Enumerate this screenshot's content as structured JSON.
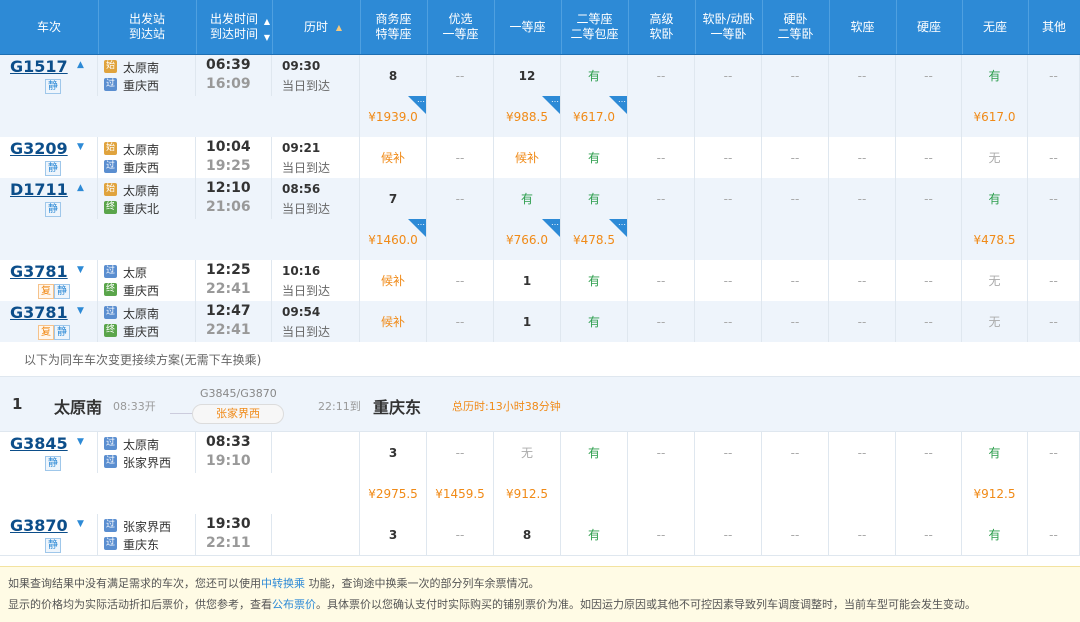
{
  "header": {
    "cols": [
      {
        "l1": "车次",
        "l2": ""
      },
      {
        "l1": "出发站",
        "l2": "到达站"
      },
      {
        "l1": "出发时间",
        "l2": "到达时间"
      },
      {
        "l1": "历时",
        "l2": ""
      },
      {
        "l1": "商务座",
        "l2": "特等座"
      },
      {
        "l1": "优选",
        "l2": "一等座"
      },
      {
        "l1": "一等座",
        "l2": ""
      },
      {
        "l1": "二等座",
        "l2": "二等包座"
      },
      {
        "l1": "高级",
        "l2": "软卧"
      },
      {
        "l1": "软卧/动卧",
        "l2": "一等卧"
      },
      {
        "l1": "硬卧",
        "l2": "二等卧"
      },
      {
        "l1": "软座",
        "l2": ""
      },
      {
        "l1": "硬座",
        "l2": ""
      },
      {
        "l1": "无座",
        "l2": ""
      },
      {
        "l1": "其他",
        "l2": ""
      }
    ]
  },
  "trains": [
    {
      "no": "G1517",
      "tags": [
        "静"
      ],
      "from": "太原南",
      "to": "重庆西",
      "from_icon": "始",
      "to_icon": "过",
      "dep": "06:39",
      "arr": "16:09",
      "dur": "09:30",
      "day": "当日到达",
      "seats": [
        "8",
        "--",
        "12",
        "有",
        "--",
        "--",
        "--",
        "--",
        "--",
        "有",
        "--"
      ],
      "prices": [
        "¥1939.0",
        "",
        "¥988.5",
        "¥617.0",
        "",
        "",
        "",
        "",
        "",
        "¥617.0",
        ""
      ]
    },
    {
      "no": "G3209",
      "tags": [
        "静"
      ],
      "from": "太原南",
      "to": "重庆西",
      "from_icon": "始",
      "to_icon": "过",
      "dep": "10:04",
      "arr": "19:25",
      "dur": "09:21",
      "day": "当日到达",
      "seats": [
        "候补",
        "--",
        "候补",
        "有",
        "--",
        "--",
        "--",
        "--",
        "--",
        "无",
        "--"
      ],
      "prices": null
    },
    {
      "no": "D1711",
      "tags": [
        "静"
      ],
      "from": "太原南",
      "to": "重庆北",
      "from_icon": "始",
      "to_icon": "终",
      "dep": "12:10",
      "arr": "21:06",
      "dur": "08:56",
      "day": "当日到达",
      "seats": [
        "7",
        "--",
        "有",
        "有",
        "--",
        "--",
        "--",
        "--",
        "--",
        "有",
        "--"
      ],
      "prices": [
        "¥1460.0",
        "",
        "¥766.0",
        "¥478.5",
        "",
        "",
        "",
        "",
        "",
        "¥478.5",
        ""
      ]
    },
    {
      "no": "G3781",
      "tags": [
        "复",
        "静"
      ],
      "from": "太原",
      "to": "重庆西",
      "from_icon": "过",
      "to_icon": "终",
      "dep": "12:25",
      "arr": "22:41",
      "dur": "10:16",
      "day": "当日到达",
      "seats": [
        "候补",
        "--",
        "1",
        "有",
        "--",
        "--",
        "--",
        "--",
        "--",
        "无",
        "--"
      ],
      "prices": null
    },
    {
      "no": "G3781",
      "tags": [
        "复",
        "静"
      ],
      "from": "太原南",
      "to": "重庆西",
      "from_icon": "过",
      "to_icon": "终",
      "dep": "12:47",
      "arr": "22:41",
      "dur": "09:54",
      "day": "当日到达",
      "seats": [
        "候补",
        "--",
        "1",
        "有",
        "--",
        "--",
        "--",
        "--",
        "--",
        "无",
        "--"
      ],
      "prices": null
    }
  ],
  "transfer_note": "以下为同车车次变更接续方案(无需下车换乘)",
  "transfer": {
    "index": "1",
    "from": "太原南",
    "dep": "08:33开",
    "trains": "G3845/G3870",
    "via": "张家界西",
    "arr": "22:11到",
    "to": "重庆东",
    "total": "总历时:13小时38分钟"
  },
  "transfer_trains": [
    {
      "no": "G3845",
      "tags": [
        "静"
      ],
      "from": "太原南",
      "to": "张家界西",
      "from_icon": "过",
      "to_icon": "过",
      "dep": "08:33",
      "arr": "19:10",
      "seats": [
        "3",
        "--",
        "无",
        "有",
        "--",
        "--",
        "--",
        "--",
        "--",
        "有",
        "--"
      ],
      "prices": [
        "¥2975.5",
        "¥1459.5",
        "¥912.5",
        "",
        "",
        "",
        "",
        "",
        "",
        "¥912.5",
        ""
      ]
    },
    {
      "no": "G3870",
      "tags": [
        "静"
      ],
      "from": "张家界西",
      "to": "重庆东",
      "from_icon": "过",
      "to_icon": "过",
      "dep": "19:30",
      "arr": "22:11",
      "seats": [
        "3",
        "--",
        "8",
        "有",
        "--",
        "--",
        "--",
        "--",
        "--",
        "有",
        "--"
      ],
      "prices": null
    }
  ],
  "footer": {
    "line1a": "如果查询结果中没有满足需求的车次，您还可以使用",
    "line1link": "中转换乘",
    "line1b": " 功能，查询途中换乘一次的部分列车余票情况。",
    "line2a": "显示的价格均为实际活动折扣后票价，供您参考，查看",
    "line2link": "公布票价",
    "line2b": "。具体票价以您确认支付时实际购买的铺别票价为准。如因运力原因或其他不可控因素导致列车调度调整时，当前车型可能会发生变动。"
  },
  "colors": {
    "header": "#2d8ad6",
    "available": "#2b9d4b",
    "price": "#f08a17",
    "link": "#2d8ad6"
  }
}
